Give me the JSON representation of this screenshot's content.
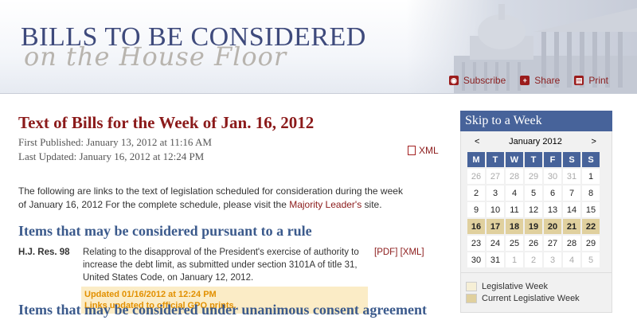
{
  "header": {
    "title_line1": "BILLS TO BE CONSIDERED",
    "title_line2": "on the House Floor",
    "tools": [
      {
        "label": "Subscribe",
        "icon": "rss-icon"
      },
      {
        "label": "Share",
        "icon": "share-plus-icon"
      },
      {
        "label": "Print",
        "icon": "printer-icon"
      }
    ]
  },
  "main": {
    "page_title": "Text of Bills for the Week of Jan. 16, 2012",
    "first_published": "First Published: January 13, 2012 at 11:16 AM",
    "last_updated": "Last Updated: January 16, 2012 at 12:24 PM",
    "xml_label": "XML",
    "intro_text": "The following are links to the text of legislation scheduled for consideration during the week of January 16, 2012 For the complete schedule, please visit the ",
    "intro_link": "Majority Leader's",
    "intro_suffix": " site.",
    "section1_heading": "Items that may be considered pursuant to a rule",
    "bill": {
      "number": "H.J. Res. 98",
      "description": "Relating to the disapproval of the President's exercise of authority to increase the debt limit, as submitted under section 3101A of title 31, United States Code, on January 12, 2012.",
      "pdf_label": "[PDF]",
      "xml_label": "[XML]",
      "update_line1": "Updated 01/16/2012 at 12:24 PM",
      "update_line2": "Links updated to official GPO prints."
    },
    "section2_heading": "Items that may be considered under unanimous consent agreement"
  },
  "sidebar": {
    "heading": "Skip to a Week",
    "prev": "<",
    "next": ">",
    "month": "January 2012",
    "days": [
      "M",
      "T",
      "W",
      "T",
      "F",
      "S",
      "S"
    ],
    "weeks": [
      {
        "type": "norm",
        "cells": [
          [
            "26",
            "out"
          ],
          [
            "27",
            "out"
          ],
          [
            "28",
            "out"
          ],
          [
            "29",
            "out"
          ],
          [
            "30",
            "out"
          ],
          [
            "31",
            "out"
          ],
          [
            "1",
            "norm"
          ]
        ]
      },
      {
        "type": "norm",
        "cells": [
          [
            "2",
            "norm"
          ],
          [
            "3",
            "norm"
          ],
          [
            "4",
            "norm"
          ],
          [
            "5",
            "norm"
          ],
          [
            "6",
            "norm"
          ],
          [
            "7",
            "norm"
          ],
          [
            "8",
            "norm"
          ]
        ]
      },
      {
        "type": "norm",
        "cells": [
          [
            "9",
            "norm"
          ],
          [
            "10",
            "norm"
          ],
          [
            "11",
            "norm"
          ],
          [
            "12",
            "norm"
          ],
          [
            "13",
            "norm"
          ],
          [
            "14",
            "norm"
          ],
          [
            "15",
            "norm"
          ]
        ]
      },
      {
        "type": "cur",
        "cells": [
          [
            "16",
            "cur"
          ],
          [
            "17",
            "cur"
          ],
          [
            "18",
            "cur"
          ],
          [
            "19",
            "cur"
          ],
          [
            "20",
            "cur"
          ],
          [
            "21",
            "cur"
          ],
          [
            "22",
            "cur"
          ]
        ]
      },
      {
        "type": "norm",
        "cells": [
          [
            "23",
            "norm"
          ],
          [
            "24",
            "norm"
          ],
          [
            "25",
            "norm"
          ],
          [
            "26",
            "norm"
          ],
          [
            "27",
            "norm"
          ],
          [
            "28",
            "norm"
          ],
          [
            "29",
            "norm"
          ]
        ]
      },
      {
        "type": "norm",
        "cells": [
          [
            "30",
            "norm"
          ],
          [
            "31",
            "norm"
          ],
          [
            "1",
            "out"
          ],
          [
            "2",
            "out"
          ],
          [
            "3",
            "out"
          ],
          [
            "4",
            "out"
          ],
          [
            "5",
            "out"
          ]
        ]
      }
    ],
    "legend": [
      {
        "label": "Legislative Week",
        "color": "#f6efd6"
      },
      {
        "label": "Current Legislative Week",
        "color": "#e0d09e"
      }
    ]
  }
}
